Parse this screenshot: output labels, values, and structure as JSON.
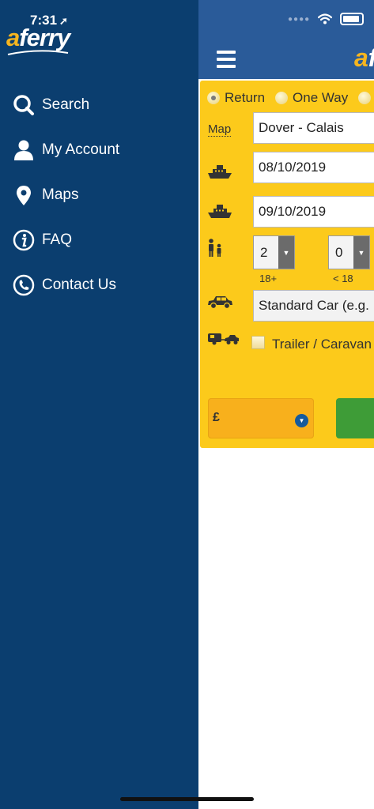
{
  "status_bar": {
    "time": "7:31",
    "location_glyph": "➚"
  },
  "brand": {
    "logo_a": "a",
    "logo_rest": "ferry",
    "header_logo_a": "a",
    "header_logo_f": "f"
  },
  "sidebar": {
    "items": [
      {
        "label": "Search",
        "icon": "search-icon"
      },
      {
        "label": "My Account",
        "icon": "user-icon"
      },
      {
        "label": "Maps",
        "icon": "map-pin-icon"
      },
      {
        "label": "FAQ",
        "icon": "info-icon"
      },
      {
        "label": "Contact Us",
        "icon": "phone-icon"
      }
    ]
  },
  "form": {
    "trip_types": [
      "Return",
      "One Way"
    ],
    "selected_trip": "Return",
    "map_link": "Map",
    "route": "Dover - Calais",
    "outbound_date": "08/10/2019",
    "return_date": "09/10/2019",
    "adults": "2",
    "adults_label": "18+",
    "children": "0",
    "children_label": "< 18",
    "vehicle": "Standard Car (e.g.",
    "trailer_label": "Trailer / Caravan",
    "currency_symbol": "£"
  },
  "colors": {
    "sidebar_bg": "#0b3e6f",
    "header_bg": "#2a5b99",
    "form_bg": "#fcca1b",
    "currency_bg": "#f8b01c",
    "search_green": "#3e9c37",
    "brand_orange": "#f6b51f"
  }
}
